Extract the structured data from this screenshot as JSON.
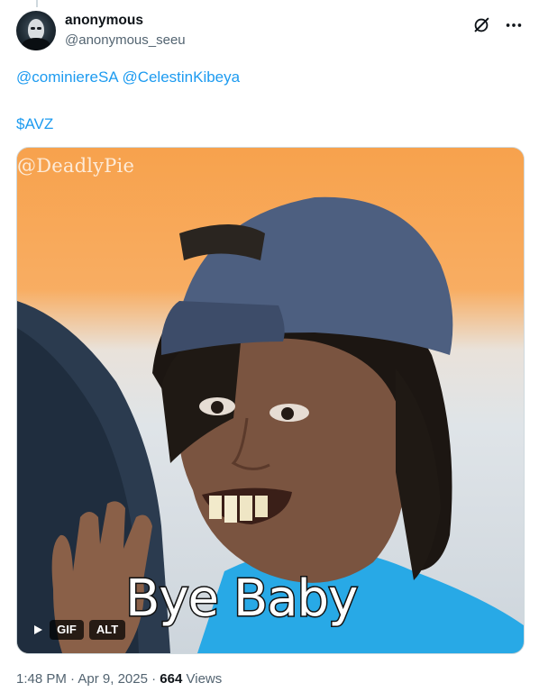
{
  "author": {
    "display_name": "anonymous",
    "handle": "@anonymous_seeu"
  },
  "tweet": {
    "mentions": [
      "@cominiereSA",
      "@CelestinKibeya"
    ],
    "cashtag": "$AVZ"
  },
  "media": {
    "watermark": "@DeadlyPie",
    "caption": "Bye Baby",
    "gif_label": "GIF",
    "alt_label": "ALT"
  },
  "meta": {
    "time": "1:48 PM",
    "separator": "·",
    "date": "Apr 9, 2025",
    "views_count": "664",
    "views_label": "Views"
  },
  "icons": {
    "grok": "grok-icon",
    "more": "more-icon",
    "play": "play-icon"
  },
  "colors": {
    "link": "#1d9bf0",
    "secondary_text": "#536471",
    "primary_text": "#0f1419"
  }
}
